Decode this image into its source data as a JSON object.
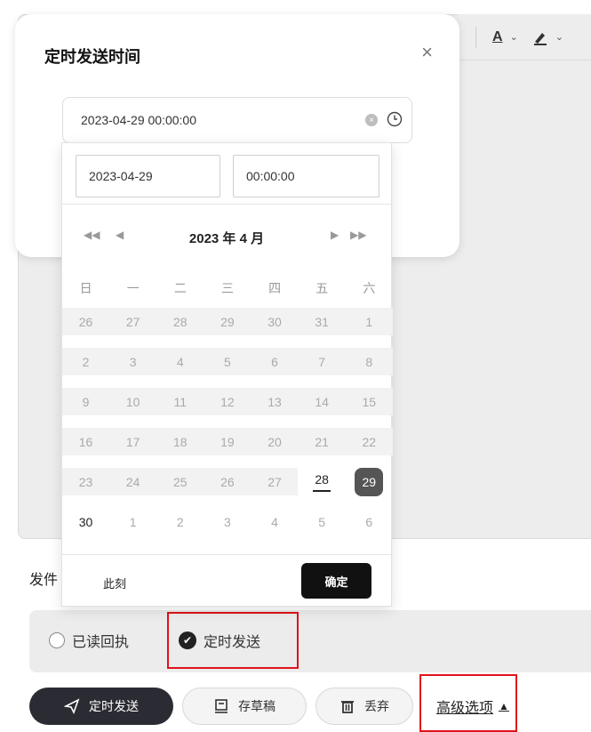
{
  "toolbar": {
    "font_color_letter": "A"
  },
  "form": {
    "sender_label": "发件"
  },
  "options": {
    "read_receipt_label": "已读回执",
    "scheduled_send_label": "定时发送"
  },
  "actions": {
    "send_label": "定时发送",
    "draft_label": "存草稿",
    "discard_label": "丢弃",
    "advanced_label": "高级选项",
    "advanced_arrow": "▲"
  },
  "dialog": {
    "title": "定时发送时间",
    "close_symbol": "×",
    "datetime_value": "2023-04-29 00:00:00"
  },
  "picker": {
    "date_value": "2023-04-29",
    "time_value": "00:00:00",
    "month_title": "2023 年  4 月",
    "nav": {
      "prev_year": "◀◀",
      "prev_month": "◀",
      "next_month": "▶",
      "next_year": "▶▶"
    },
    "weekdays": [
      "日",
      "一",
      "二",
      "三",
      "四",
      "五",
      "六"
    ],
    "weeks": [
      [
        "26",
        "27",
        "28",
        "29",
        "30",
        "31",
        "1"
      ],
      [
        "2",
        "3",
        "4",
        "5",
        "6",
        "7",
        "8"
      ],
      [
        "9",
        "10",
        "11",
        "12",
        "13",
        "14",
        "15"
      ],
      [
        "16",
        "17",
        "18",
        "19",
        "20",
        "21",
        "22"
      ],
      [
        "23",
        "24",
        "25",
        "26",
        "27",
        "28",
        "29"
      ],
      [
        "30",
        "1",
        "2",
        "3",
        "4",
        "5",
        "6"
      ]
    ],
    "now_label": "此刻",
    "confirm_label": "确定"
  }
}
